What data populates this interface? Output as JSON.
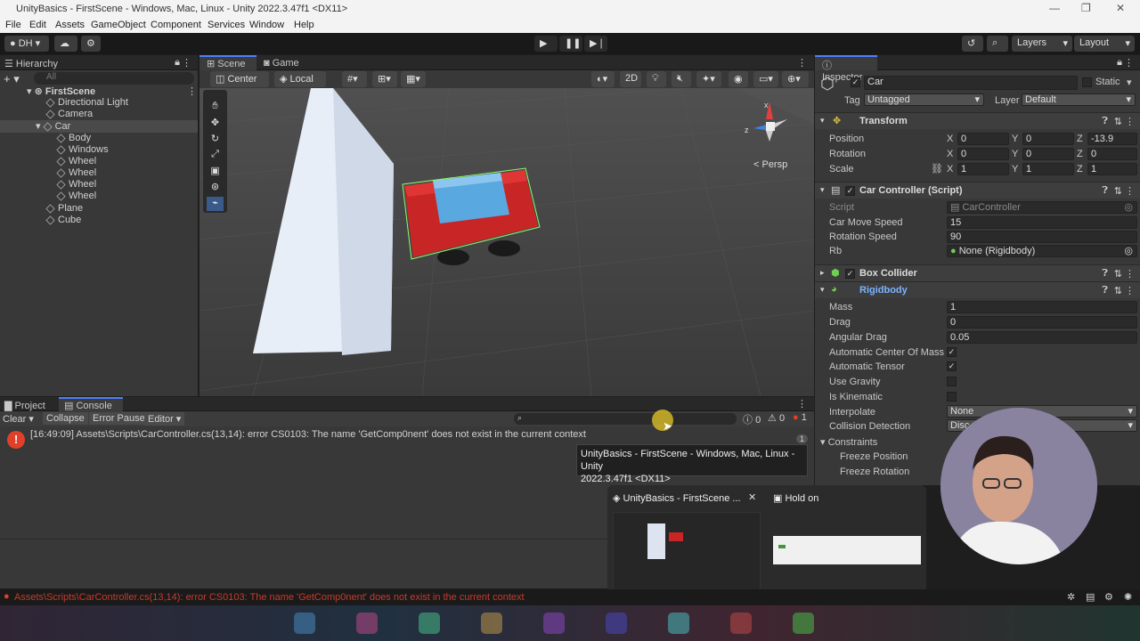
{
  "window": {
    "title": "UnityBasics - FirstScene - Windows, Mac, Linux - Unity 2022.3.47f1 <DX11>"
  },
  "menu": [
    "File",
    "Edit",
    "Assets",
    "GameObject",
    "Component",
    "Services",
    "Window",
    "Help"
  ],
  "toolbar": {
    "account": "DH",
    "layers": "Layers",
    "layout": "Layout"
  },
  "hierarchy": {
    "tab": "Hierarchy",
    "search_placeholder": "All",
    "scene": "FirstScene",
    "items": [
      {
        "label": "Directional Light"
      },
      {
        "label": "Camera"
      },
      {
        "label": "Car"
      },
      {
        "label": "Body"
      },
      {
        "label": "Windows"
      },
      {
        "label": "Wheel"
      },
      {
        "label": "Wheel"
      },
      {
        "label": "Wheel"
      },
      {
        "label": "Wheel"
      },
      {
        "label": "Plane"
      },
      {
        "label": "Cube"
      }
    ]
  },
  "scene": {
    "tabs": [
      "Scene",
      "Game"
    ],
    "pivot": "Center",
    "space": "Local",
    "mode2d": "2D",
    "persp": "< Persp",
    "axis_x": "x",
    "axis_z": "z"
  },
  "inspector": {
    "tab": "Inspector",
    "name": "Car",
    "static": "Static",
    "tag_label": "Tag",
    "tag": "Untagged",
    "layer_label": "Layer",
    "layer": "Default",
    "transform": {
      "title": "Transform",
      "position_label": "Position",
      "rotation_label": "Rotation",
      "scale_label": "Scale",
      "position": [
        "0",
        "0",
        "-13.9"
      ],
      "rotation": [
        "0",
        "0",
        "0"
      ],
      "scale": [
        "1",
        "1",
        "1"
      ],
      "axes": [
        "X",
        "Y",
        "Z"
      ]
    },
    "car_controller": {
      "title": "Car Controller (Script)",
      "script_label": "Script",
      "script": "CarController",
      "move_speed_label": "Car Move Speed",
      "move_speed": "15",
      "rotation_speed_label": "Rotation Speed",
      "rotation_speed": "90",
      "rb_label": "Rb",
      "rb": "None (Rigidbody)"
    },
    "box_collider": {
      "title": "Box Collider"
    },
    "rigidbody": {
      "title": "Rigidbody",
      "mass_label": "Mass",
      "mass": "1",
      "drag_label": "Drag",
      "drag": "0",
      "angular_drag_label": "Angular Drag",
      "angular_drag": "0.05",
      "auto_com_label": "Automatic Center Of Mass",
      "auto_tensor_label": "Automatic Tensor",
      "use_gravity_label": "Use Gravity",
      "is_kinematic_label": "Is Kinematic",
      "interpolate_label": "Interpolate",
      "interpolate": "None",
      "collision_label": "Collision Detection",
      "collision": "Disc",
      "constraints_label": "Constraints",
      "freeze_pos_label": "Freeze Position",
      "freeze_rot_label": "Freeze Rotation"
    }
  },
  "console": {
    "tabs": [
      "Project",
      "Console"
    ],
    "clear": "Clear",
    "collapse": "Collapse",
    "error_pause": "Error Pause",
    "editor": "Editor",
    "count_log": "0",
    "count_warn": "0",
    "count_err": "1",
    "message": "[16:49:09] Assets\\Scripts\\CarController.cs(13,14): error CS0103: The name 'GetComp0nent' does not exist in the current context",
    "repeat": "1"
  },
  "tooltip": {
    "line1": "UnityBasics - FirstScene - Windows, Mac, Linux - Unity",
    "line2": "2022.3.47f1 <DX11>"
  },
  "taskbar_popup": {
    "item1": "UnityBasics - FirstScene ...",
    "item2": "Hold on"
  },
  "status": {
    "message": "Assets\\Scripts\\CarController.cs(13,14): error CS0103: The name 'GetComp0nent' does not exist in the current context"
  },
  "colors": {
    "accent": "#4c7fff",
    "error": "#e0402a",
    "car_body": "#d42a2a",
    "car_window": "#5aa8e0"
  }
}
